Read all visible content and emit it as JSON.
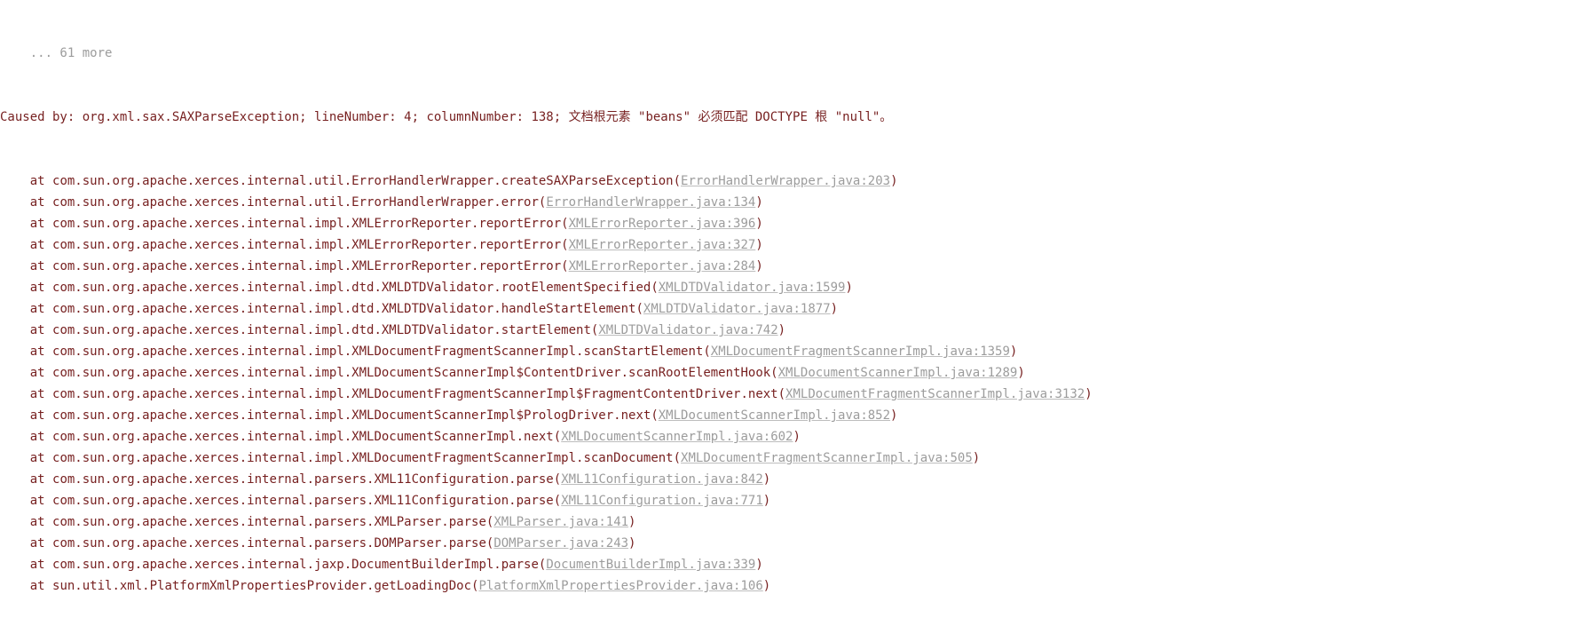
{
  "top_ellipsis": "    ... 61 more",
  "caused_by_prefix": "Caused by: ",
  "exception": "org.xml.sax.SAXParseException; lineNumber: 4; columnNumber: 138; 文档根元素 \"beans\" 必须匹配 DOCTYPE 根 \"null\"。",
  "frames": [
    {
      "at": "    at ",
      "class": "com.sun.org.apache.xerces.internal.util.ErrorHandlerWrapper.createSAXParseException",
      "open": "(",
      "link": "ErrorHandlerWrapper.java:203",
      "close": ")"
    },
    {
      "at": "    at ",
      "class": "com.sun.org.apache.xerces.internal.util.ErrorHandlerWrapper.error",
      "open": "(",
      "link": "ErrorHandlerWrapper.java:134",
      "close": ")"
    },
    {
      "at": "    at ",
      "class": "com.sun.org.apache.xerces.internal.impl.XMLErrorReporter.reportError",
      "open": "(",
      "link": "XMLErrorReporter.java:396",
      "close": ")"
    },
    {
      "at": "    at ",
      "class": "com.sun.org.apache.xerces.internal.impl.XMLErrorReporter.reportError",
      "open": "(",
      "link": "XMLErrorReporter.java:327",
      "close": ")"
    },
    {
      "at": "    at ",
      "class": "com.sun.org.apache.xerces.internal.impl.XMLErrorReporter.reportError",
      "open": "(",
      "link": "XMLErrorReporter.java:284",
      "close": ")"
    },
    {
      "at": "    at ",
      "class": "com.sun.org.apache.xerces.internal.impl.dtd.XMLDTDValidator.rootElementSpecified",
      "open": "(",
      "link": "XMLDTDValidator.java:1599",
      "close": ")"
    },
    {
      "at": "    at ",
      "class": "com.sun.org.apache.xerces.internal.impl.dtd.XMLDTDValidator.handleStartElement",
      "open": "(",
      "link": "XMLDTDValidator.java:1877",
      "close": ")"
    },
    {
      "at": "    at ",
      "class": "com.sun.org.apache.xerces.internal.impl.dtd.XMLDTDValidator.startElement",
      "open": "(",
      "link": "XMLDTDValidator.java:742",
      "close": ")"
    },
    {
      "at": "    at ",
      "class": "com.sun.org.apache.xerces.internal.impl.XMLDocumentFragmentScannerImpl.scanStartElement",
      "open": "(",
      "link": "XMLDocumentFragmentScannerImpl.java:1359",
      "close": ")"
    },
    {
      "at": "    at ",
      "class": "com.sun.org.apache.xerces.internal.impl.XMLDocumentScannerImpl$ContentDriver.scanRootElementHook",
      "open": "(",
      "link": "XMLDocumentScannerImpl.java:1289",
      "close": ")"
    },
    {
      "at": "    at ",
      "class": "com.sun.org.apache.xerces.internal.impl.XMLDocumentFragmentScannerImpl$FragmentContentDriver.next",
      "open": "(",
      "link": "XMLDocumentFragmentScannerImpl.java:3132",
      "close": ")"
    },
    {
      "at": "    at ",
      "class": "com.sun.org.apache.xerces.internal.impl.XMLDocumentScannerImpl$PrologDriver.next",
      "open": "(",
      "link": "XMLDocumentScannerImpl.java:852",
      "close": ")"
    },
    {
      "at": "    at ",
      "class": "com.sun.org.apache.xerces.internal.impl.XMLDocumentScannerImpl.next",
      "open": "(",
      "link": "XMLDocumentScannerImpl.java:602",
      "close": ")"
    },
    {
      "at": "    at ",
      "class": "com.sun.org.apache.xerces.internal.impl.XMLDocumentFragmentScannerImpl.scanDocument",
      "open": "(",
      "link": "XMLDocumentFragmentScannerImpl.java:505",
      "close": ")"
    },
    {
      "at": "    at ",
      "class": "com.sun.org.apache.xerces.internal.parsers.XML11Configuration.parse",
      "open": "(",
      "link": "XML11Configuration.java:842",
      "close": ")"
    },
    {
      "at": "    at ",
      "class": "com.sun.org.apache.xerces.internal.parsers.XML11Configuration.parse",
      "open": "(",
      "link": "XML11Configuration.java:771",
      "close": ")"
    },
    {
      "at": "    at ",
      "class": "com.sun.org.apache.xerces.internal.parsers.XMLParser.parse",
      "open": "(",
      "link": "XMLParser.java:141",
      "close": ")"
    },
    {
      "at": "    at ",
      "class": "com.sun.org.apache.xerces.internal.parsers.DOMParser.parse",
      "open": "(",
      "link": "DOMParser.java:243",
      "close": ")"
    },
    {
      "at": "    at ",
      "class": "com.sun.org.apache.xerces.internal.jaxp.DocumentBuilderImpl.parse",
      "open": "(",
      "link": "DocumentBuilderImpl.java:339",
      "close": ")"
    },
    {
      "at": "    at ",
      "class": "sun.util.xml.PlatformXmlPropertiesProvider.getLoadingDoc",
      "open": "(",
      "link": "PlatformXmlPropertiesProvider.java:106",
      "close": ")"
    }
  ]
}
